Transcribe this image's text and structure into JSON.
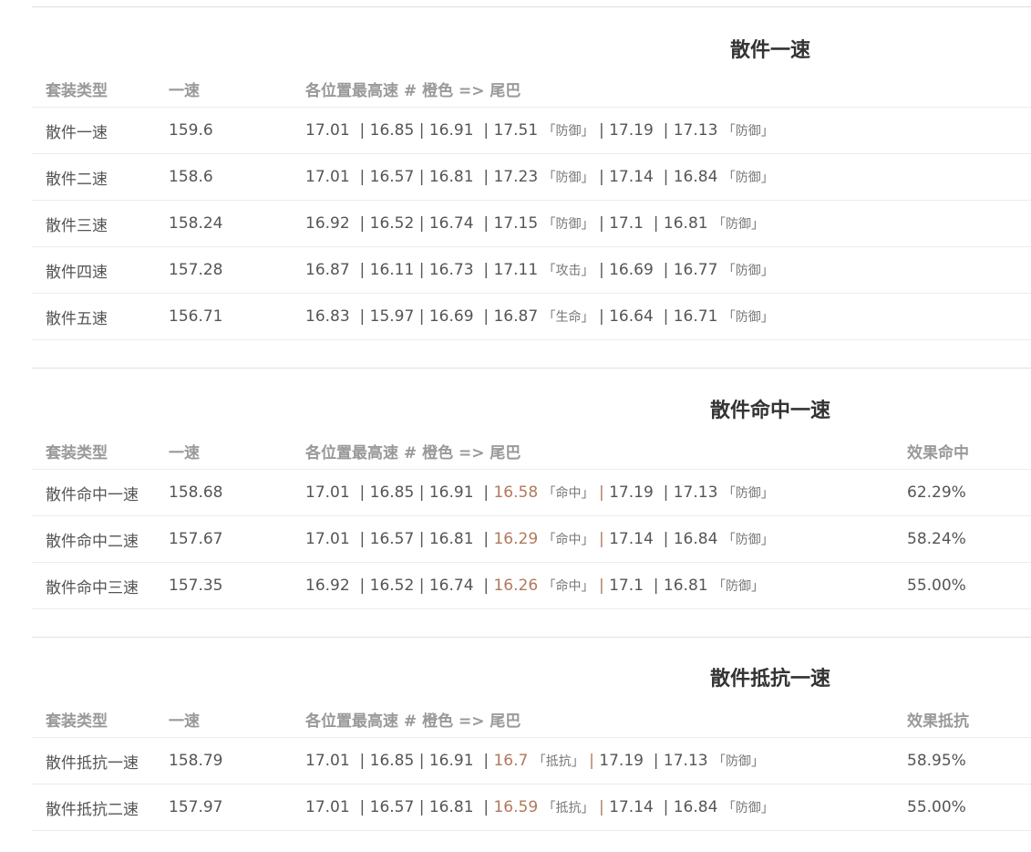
{
  "sections": [
    {
      "title": "散件一速",
      "headers": [
        "套装类型",
        "一速",
        "各位置最高速 # 橙色 => 尾巴"
      ],
      "rows": [
        {
          "name": "散件一速",
          "speed": "159.6",
          "v": [
            "17.01",
            "16.85",
            "16.91",
            "17.51",
            "17.19",
            "17.13"
          ],
          "t3": "「防御」",
          "t5": "「防御」"
        },
        {
          "name": "散件二速",
          "speed": "158.6",
          "v": [
            "17.01",
            "16.57",
            "16.81",
            "17.23",
            "17.14",
            "16.84"
          ],
          "t3": "「防御」",
          "t5": "「防御」"
        },
        {
          "name": "散件三速",
          "speed": "158.24",
          "v": [
            "16.92",
            "16.52",
            "16.74",
            "17.15",
            "17.1",
            "16.81"
          ],
          "t3": "「防御」",
          "t5": "「防御」"
        },
        {
          "name": "散件四速",
          "speed": "157.28",
          "v": [
            "16.87",
            "16.11",
            "16.73",
            "17.11",
            "16.69",
            "16.77"
          ],
          "t3": "「攻击」",
          "t5": "「防御」"
        },
        {
          "name": "散件五速",
          "speed": "156.71",
          "v": [
            "16.83",
            "15.97",
            "16.69",
            "16.87",
            "16.64",
            "16.71"
          ],
          "t3": "「生命」",
          "t5": "「防御」"
        }
      ]
    },
    {
      "title": "散件命中一速",
      "headers": [
        "套装类型",
        "一速",
        "各位置最高速 # 橙色 => 尾巴",
        "效果命中"
      ],
      "rows": [
        {
          "name": "散件命中一速",
          "speed": "158.68",
          "v": [
            "17.01",
            "16.85",
            "16.91",
            "16.58",
            "17.19",
            "17.13"
          ],
          "t3": "「命中」",
          "t5": "「防御」",
          "extra": "62.29%"
        },
        {
          "name": "散件命中二速",
          "speed": "157.67",
          "v": [
            "17.01",
            "16.57",
            "16.81",
            "16.29",
            "17.14",
            "16.84"
          ],
          "t3": "「命中」",
          "t5": "「防御」",
          "extra": "58.24%"
        },
        {
          "name": "散件命中三速",
          "speed": "157.35",
          "v": [
            "16.92",
            "16.52",
            "16.74",
            "16.26",
            "17.1",
            "16.81"
          ],
          "t3": "「命中」",
          "t5": "「防御」",
          "extra": "55.00%"
        }
      ]
    },
    {
      "title": "散件抵抗一速",
      "headers": [
        "套装类型",
        "一速",
        "各位置最高速 # 橙色 => 尾巴",
        "效果抵抗"
      ],
      "rows": [
        {
          "name": "散件抵抗一速",
          "speed": "158.79",
          "v": [
            "17.01",
            "16.85",
            "16.91",
            "16.7",
            "17.19",
            "17.13"
          ],
          "t3": "「抵抗」",
          "t5": "「防御」",
          "extra": "58.95%"
        },
        {
          "name": "散件抵抗二速",
          "speed": "157.97",
          "v": [
            "17.01",
            "16.57",
            "16.81",
            "16.59",
            "17.14",
            "16.84"
          ],
          "t3": "「抵抗」",
          "t5": "「防御」",
          "extra": "55.00%"
        }
      ]
    }
  ]
}
